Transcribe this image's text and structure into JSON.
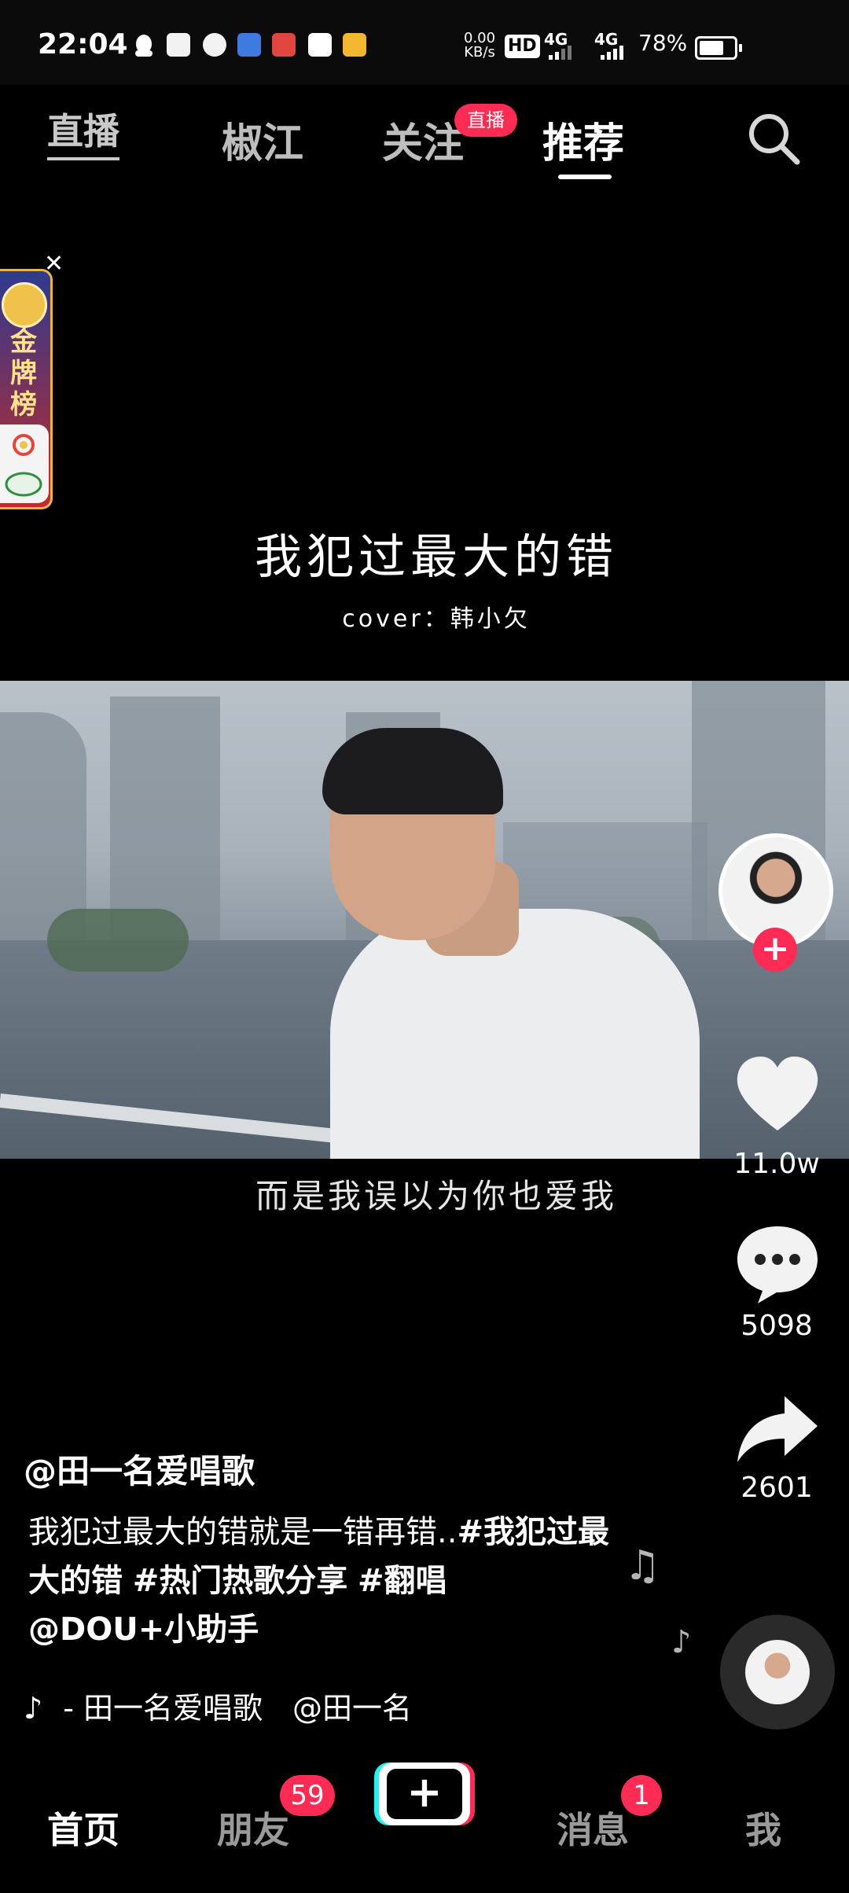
{
  "status_bar": {
    "time": "22:04",
    "net_speed_value": "0.00",
    "net_speed_unit": "KB/s",
    "hd": "HD",
    "signal_1": "4G",
    "signal_2": "4G",
    "battery": "78%",
    "battery_level": 0.78,
    "notification_icons": [
      "qq-icon",
      "app-icon",
      "app-icon",
      "app-icon",
      "app-icon",
      "vipshop-icon",
      "app-icon"
    ]
  },
  "top_nav": {
    "live_label": "直播",
    "tabs": [
      {
        "label": "椒江"
      },
      {
        "label": "关注",
        "badge": "直播"
      },
      {
        "label": "推荐",
        "active": true
      }
    ]
  },
  "activity_banner": {
    "text": "金牌榜"
  },
  "video_overlay": {
    "title": "我犯过最大的错",
    "cover": "cover：韩小欠",
    "lyric": "而是我误以为你也爱我"
  },
  "right_rail": {
    "likes": "11.0w",
    "comments": "5098",
    "shares": "2601"
  },
  "post": {
    "author": "@田一名爱唱歌",
    "caption_plain": "我犯过最大的错就是一错再错..",
    "caption_tag1": "#我犯过最大的错",
    "caption_tag2": "#热门热歌分享",
    "caption_tag3": "#翻唱",
    "caption_mention": "@DOU+小助手",
    "music": "- 田一名爱唱歌　@田一名"
  },
  "bottom_nav": {
    "home": "首页",
    "friends": "朋友",
    "friends_badge": "59",
    "messages": "消息",
    "messages_badge": "1",
    "me": "我",
    "create": "+"
  }
}
